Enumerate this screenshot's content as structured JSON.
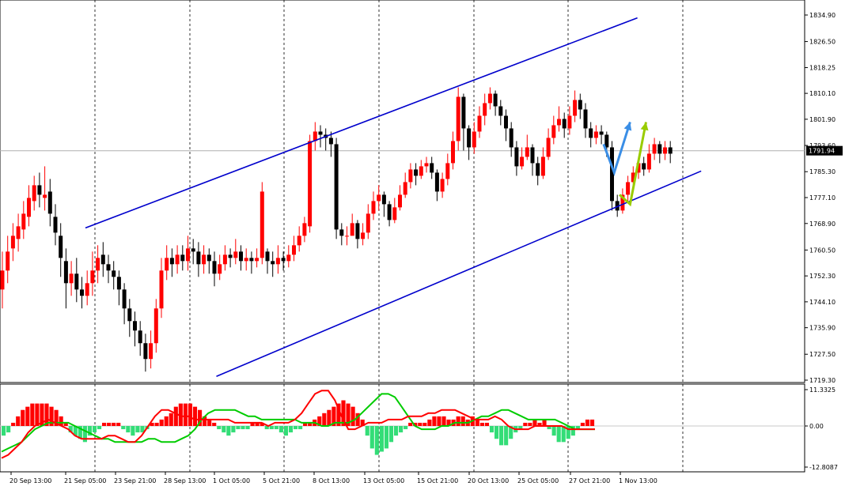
{
  "chart_data": [
    {
      "type": "candlestick",
      "panel": "main",
      "instrument_price": "1791.94",
      "y_ticks": [
        "1834.90",
        "1826.50",
        "1818.25",
        "1810.10",
        "1801.90",
        "1793.60",
        "1785.30",
        "1777.10",
        "1768.90",
        "1760.50",
        "1752.30",
        "1744.10",
        "1735.90",
        "1727.50",
        "1719.30"
      ],
      "ylim": [
        1719.3,
        1834.9
      ],
      "x_labels": [
        "20 Sep 13:00",
        "21 Sep 05:00",
        "23 Sep 21:00",
        "28 Sep 13:00",
        "1 Oct 05:00",
        "5 Oct 21:00",
        "8 Oct 13:00",
        "13 Oct 05:00",
        "15 Oct 21:00",
        "20 Oct 13:00",
        "25 Oct 05:00",
        "27 Oct 21:00",
        "1 Nov 13:00"
      ],
      "bull_color": "#ff0000",
      "bear_color": "#000000",
      "channel": {
        "color": "#0000cc",
        "upper_line": [
          [
            0,
            1767.5
          ],
          [
            78,
            1834.0
          ]
        ],
        "lower_line": [
          [
            15,
            1720.5
          ],
          [
            96,
            1785.5
          ]
        ]
      },
      "candles": [
        [
          1754,
          1748,
          1760,
          1742
        ],
        [
          1760,
          1754,
          1765,
          1750
        ],
        [
          1765,
          1761,
          1769,
          1757
        ],
        [
          1768,
          1764,
          1772,
          1760
        ],
        [
          1772,
          1767,
          1776,
          1764
        ],
        [
          1777,
          1771,
          1781,
          1768
        ],
        [
          1781,
          1776,
          1784,
          1773
        ],
        [
          1778,
          1781,
          1785,
          1774
        ],
        [
          1778,
          1777,
          1787,
          1773
        ],
        [
          1772,
          1779,
          1783,
          1768
        ],
        [
          1766,
          1771,
          1775,
          1762
        ],
        [
          1758,
          1765,
          1769,
          1752
        ],
        [
          1750,
          1757,
          1761,
          1742
        ],
        [
          1753,
          1750,
          1757,
          1746
        ],
        [
          1748,
          1753,
          1758,
          1744
        ],
        [
          1746,
          1748,
          1752,
          1742
        ],
        [
          1750,
          1746,
          1754,
          1743
        ],
        [
          1754,
          1750,
          1760,
          1746
        ],
        [
          1758,
          1754,
          1762,
          1750
        ],
        [
          1756,
          1759,
          1763,
          1752
        ],
        [
          1754,
          1756,
          1759,
          1750
        ],
        [
          1752,
          1754,
          1757,
          1748
        ],
        [
          1748,
          1752,
          1754,
          1743
        ],
        [
          1742,
          1748,
          1750,
          1737
        ],
        [
          1738,
          1742,
          1745,
          1733
        ],
        [
          1735,
          1738,
          1741,
          1730
        ],
        [
          1731,
          1735,
          1738,
          1727
        ],
        [
          1726,
          1731,
          1734,
          1722
        ],
        [
          1731,
          1726,
          1735,
          1723
        ],
        [
          1742,
          1731,
          1745,
          1728
        ],
        [
          1754,
          1742,
          1758,
          1739
        ],
        [
          1758,
          1754,
          1762,
          1751
        ],
        [
          1756,
          1758,
          1761,
          1752
        ],
        [
          1759,
          1756,
          1762,
          1753
        ],
        [
          1757,
          1759,
          1762,
          1754
        ],
        [
          1761,
          1757,
          1765,
          1754
        ],
        [
          1760,
          1761,
          1764,
          1756
        ],
        [
          1756,
          1760,
          1763,
          1752
        ],
        [
          1759,
          1756,
          1762,
          1753
        ],
        [
          1757,
          1759,
          1761,
          1753
        ],
        [
          1753,
          1757,
          1760,
          1749
        ],
        [
          1756,
          1753,
          1759,
          1751
        ],
        [
          1759,
          1756,
          1762,
          1754
        ],
        [
          1758,
          1759,
          1761,
          1755
        ],
        [
          1760,
          1758,
          1764,
          1756
        ],
        [
          1757,
          1760,
          1762,
          1754
        ],
        [
          1758,
          1757,
          1761,
          1754
        ],
        [
          1757,
          1758,
          1760,
          1753
        ],
        [
          1758,
          1757,
          1761,
          1755
        ],
        [
          1779,
          1758,
          1782,
          1756
        ],
        [
          1757,
          1760,
          1761,
          1753
        ],
        [
          1756,
          1757,
          1760,
          1752
        ],
        [
          1758,
          1756,
          1762,
          1753
        ],
        [
          1757,
          1758,
          1760,
          1754
        ],
        [
          1759,
          1757,
          1762,
          1755
        ],
        [
          1762,
          1759,
          1765,
          1757
        ],
        [
          1765,
          1762,
          1768,
          1760
        ],
        [
          1769,
          1765,
          1771,
          1763
        ],
        [
          1795,
          1768,
          1797,
          1766
        ],
        [
          1798,
          1795,
          1801,
          1792
        ],
        [
          1797,
          1798,
          1800,
          1793
        ],
        [
          1796,
          1797,
          1799,
          1792
        ],
        [
          1794,
          1796,
          1798,
          1790
        ],
        [
          1767,
          1794,
          1796,
          1764
        ],
        [
          1765,
          1767,
          1769,
          1762
        ],
        [
          1765,
          1765,
          1768,
          1762
        ],
        [
          1769,
          1765,
          1772,
          1766
        ],
        [
          1764,
          1769,
          1770,
          1761
        ],
        [
          1766,
          1764,
          1769,
          1762
        ],
        [
          1772,
          1766,
          1775,
          1764
        ],
        [
          1776,
          1772,
          1779,
          1770
        ],
        [
          1778,
          1776,
          1781,
          1773
        ],
        [
          1775,
          1778,
          1779,
          1771
        ],
        [
          1770,
          1775,
          1776,
          1768
        ],
        [
          1774,
          1770,
          1777,
          1769
        ],
        [
          1778,
          1774,
          1781,
          1773
        ],
        [
          1782,
          1778,
          1785,
          1777
        ],
        [
          1786,
          1782,
          1788,
          1780
        ],
        [
          1784,
          1786,
          1788,
          1781
        ],
        [
          1787,
          1784,
          1789,
          1783
        ],
        [
          1788,
          1787,
          1790,
          1785
        ],
        [
          1785,
          1788,
          1790,
          1783
        ],
        [
          1779,
          1785,
          1786,
          1776
        ],
        [
          1783,
          1779,
          1785,
          1777
        ],
        [
          1788,
          1783,
          1791,
          1781
        ],
        [
          1795,
          1788,
          1798,
          1786
        ],
        [
          1809,
          1795,
          1812,
          1792
        ],
        [
          1799,
          1809,
          1810,
          1792
        ],
        [
          1793,
          1799,
          1800,
          1789
        ],
        [
          1798,
          1793,
          1801,
          1791
        ],
        [
          1803,
          1798,
          1806,
          1796
        ],
        [
          1807,
          1803,
          1810,
          1800
        ],
        [
          1810,
          1807,
          1812,
          1805
        ],
        [
          1806,
          1810,
          1811,
          1803
        ],
        [
          1803,
          1806,
          1808,
          1800
        ],
        [
          1799,
          1803,
          1805,
          1795
        ],
        [
          1793,
          1799,
          1801,
          1790
        ],
        [
          1787,
          1793,
          1795,
          1784
        ],
        [
          1790,
          1787,
          1793,
          1786
        ],
        [
          1793,
          1790,
          1797,
          1789
        ],
        [
          1788,
          1793,
          1794,
          1784
        ],
        [
          1784,
          1788,
          1790,
          1781
        ],
        [
          1790,
          1784,
          1793,
          1783
        ],
        [
          1796,
          1790,
          1799,
          1789
        ],
        [
          1800,
          1796,
          1803,
          1794
        ],
        [
          1802,
          1800,
          1806,
          1798
        ],
        [
          1799,
          1802,
          1804,
          1796
        ],
        [
          1803,
          1799,
          1806,
          1797
        ],
        [
          1808,
          1803,
          1811,
          1801
        ],
        [
          1805,
          1808,
          1810,
          1802
        ],
        [
          1799,
          1805,
          1807,
          1796
        ],
        [
          1796,
          1799,
          1801,
          1793
        ],
        [
          1798,
          1796,
          1800,
          1794
        ],
        [
          1797,
          1798,
          1800,
          1794
        ],
        [
          1793,
          1797,
          1798,
          1790
        ],
        [
          1776,
          1793,
          1795,
          1773
        ],
        [
          1773,
          1776,
          1778,
          1771
        ],
        [
          1778,
          1773,
          1780,
          1772
        ],
        [
          1782,
          1778,
          1784,
          1776
        ],
        [
          1785,
          1782,
          1787,
          1780
        ],
        [
          1788,
          1785,
          1790,
          1783
        ],
        [
          1786,
          1788,
          1790,
          1784
        ],
        [
          1791,
          1786,
          1794,
          1785
        ],
        [
          1794,
          1791,
          1796,
          1789
        ],
        [
          1791,
          1794,
          1795,
          1788
        ],
        [
          1793,
          1791,
          1795,
          1789
        ],
        [
          1791,
          1793,
          1795,
          1788
        ]
      ],
      "arrows": [
        {
          "color": "#3a8ee6",
          "points": [
            [
              97,
              1794
            ],
            [
              99,
              1785
            ],
            [
              102,
              1801
            ]
          ]
        },
        {
          "color": "#99cc00",
          "points": [
            [
              100,
              1778
            ],
            [
              102,
              1775
            ],
            [
              105,
              1801
            ]
          ]
        }
      ],
      "grid": "vertical dashed"
    },
    {
      "type": "histogram",
      "panel": "macd",
      "y_ticks": [
        "11.3325",
        "0.00",
        "-12.8087"
      ],
      "ylim": [
        -12.8087,
        11.3325
      ],
      "pos_color": "#ff0000",
      "neg_color": "#33dd77",
      "signal_color": "#00cc00",
      "main_line_color": "#ff0000",
      "histogram": [
        -3,
        -2,
        1,
        3,
        5,
        6,
        7,
        7,
        7,
        7,
        6,
        5,
        3,
        1,
        -2,
        -3,
        -4,
        -5,
        -3,
        -2,
        -1,
        1,
        1,
        1,
        1,
        -1,
        -2,
        -3,
        -2,
        -2,
        -1,
        1,
        1,
        2,
        3,
        4,
        6,
        7,
        7,
        7,
        6,
        5,
        3,
        2,
        1,
        -1,
        -2,
        -3,
        -2,
        -1,
        -1,
        -1,
        1,
        1,
        1,
        -1,
        -1,
        -1,
        -2,
        -3,
        -2,
        -1,
        -1,
        1,
        1,
        2,
        3,
        4,
        5,
        6,
        7,
        8,
        7,
        6,
        4,
        2,
        -3,
        -7,
        -9,
        -8,
        -7,
        -5,
        -3,
        -2,
        -1,
        1,
        1,
        1,
        1,
        2,
        3,
        3,
        3,
        2,
        2,
        3,
        3,
        2,
        3,
        2,
        1,
        1,
        -2,
        -4,
        -6,
        -6,
        -4,
        -2,
        -1,
        1,
        1,
        2,
        1,
        2,
        -1,
        -3,
        -5,
        -5,
        -4,
        -3,
        -1,
        1,
        2,
        2
      ],
      "signal": [
        -8,
        -7,
        -6,
        -5,
        -3,
        -1,
        0,
        1,
        1,
        1,
        1,
        0,
        -1,
        -2,
        -3,
        -4,
        -4,
        -5,
        -5,
        -5,
        -5,
        -5,
        -4,
        -4,
        -5,
        -5,
        -5,
        -4,
        -3,
        -1,
        2,
        4,
        5,
        5,
        5,
        5,
        4,
        3,
        3,
        2,
        2,
        2,
        2,
        2,
        2,
        1,
        1,
        1,
        0,
        0,
        1,
        1,
        1,
        2,
        4,
        6,
        8,
        10,
        10,
        9,
        6,
        3,
        0,
        -1,
        -1,
        -1,
        0,
        0,
        1,
        1,
        1,
        2,
        3,
        3,
        4,
        5,
        5,
        4,
        3,
        2,
        2,
        2,
        2,
        2,
        1,
        0,
        -1,
        -1,
        -1,
        -1
      ],
      "main": [
        -10,
        -9,
        -7,
        -5,
        -2,
        0,
        1,
        2,
        1,
        0,
        -1,
        -3,
        -4,
        -4,
        -4,
        -4,
        -3,
        -3,
        -4,
        -5,
        -5,
        -3,
        0,
        3,
        5,
        5,
        4,
        3,
        3,
        2,
        2,
        2,
        2,
        2,
        2,
        1,
        1,
        1,
        1,
        1,
        0,
        1,
        1,
        1,
        2,
        4,
        7,
        10,
        11,
        11,
        8,
        3,
        -1,
        -1,
        0,
        1,
        1,
        1,
        2,
        2,
        2,
        3,
        3,
        3,
        4,
        4,
        5,
        5,
        5,
        4,
        3,
        2,
        2,
        2,
        3,
        2,
        0,
        -1,
        -1,
        -1,
        0,
        0,
        0,
        0,
        0,
        -1,
        -1,
        -1,
        -1,
        -1
      ]
    }
  ]
}
